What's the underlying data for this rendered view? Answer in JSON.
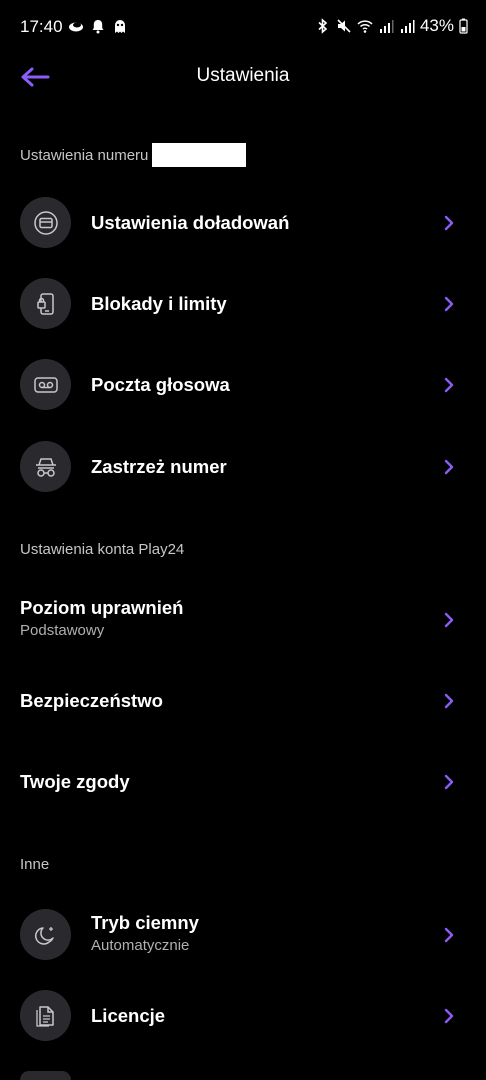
{
  "status_bar": {
    "time": "17:40",
    "battery": "43%",
    "left_icons": [
      "weather-icon",
      "bell-icon",
      "ghost-icon"
    ],
    "right_icons": [
      "bluetooth-icon",
      "mute-icon",
      "wifi-icon",
      "signal-icon",
      "signal-icon",
      "battery-icon"
    ]
  },
  "header": {
    "title": "Ustawienia",
    "back_icon": "arrow-left-icon"
  },
  "sections": {
    "number": {
      "label": "Ustawienia numeru",
      "items": [
        {
          "title": "Ustawienia doładowań",
          "icon": "topup-card-icon"
        },
        {
          "title": "Blokady i limity",
          "icon": "phone-lock-icon"
        },
        {
          "title": "Poczta głosowa",
          "icon": "voicemail-icon"
        },
        {
          "title": "Zastrzeż numer",
          "icon": "incognito-icon"
        }
      ]
    },
    "account": {
      "label": "Ustawienia konta Play24",
      "items": [
        {
          "title": "Poziom uprawnień",
          "subtitle": "Podstawowy"
        },
        {
          "title": "Bezpieczeństwo"
        },
        {
          "title": "Twoje zgody"
        }
      ]
    },
    "other": {
      "label": "Inne",
      "items": [
        {
          "title": "Tryb ciemny",
          "subtitle": "Automatycznie",
          "icon": "moon-icon"
        },
        {
          "title": "Licencje",
          "icon": "documents-icon"
        }
      ]
    }
  },
  "colors": {
    "background": "#000000",
    "accent": "#8b5cf6",
    "icon_circle": "#2a2a2e",
    "secondary_text": "#b0b0b3"
  }
}
